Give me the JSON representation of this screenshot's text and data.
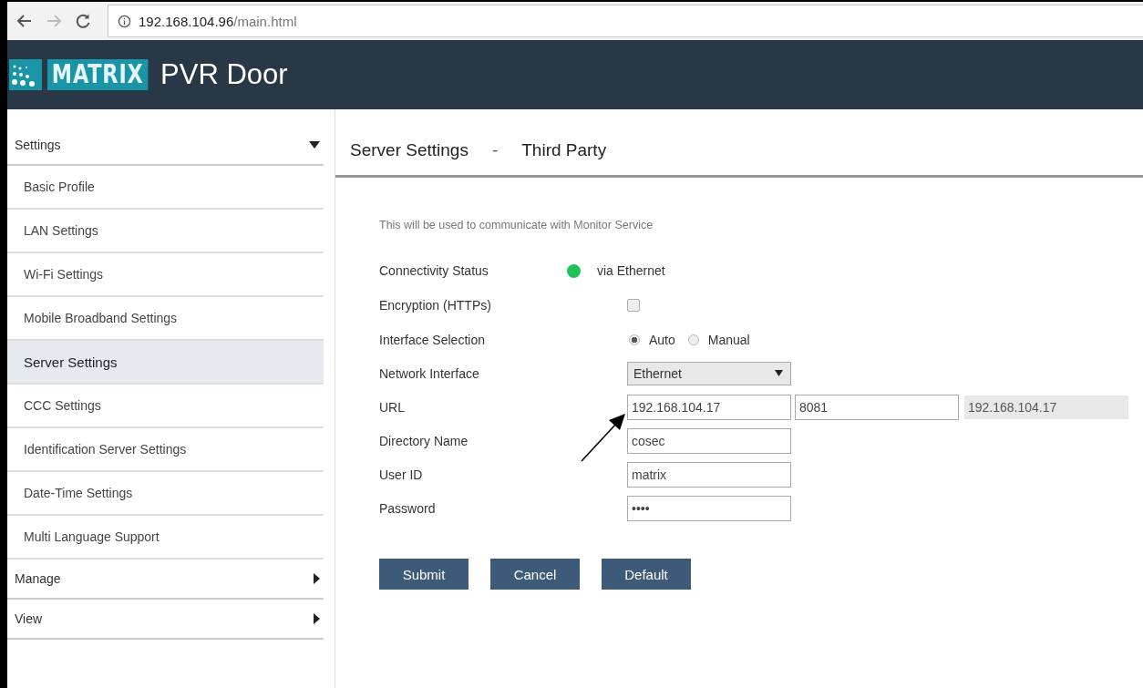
{
  "browser": {
    "url_host": "192.168.104.96",
    "url_path": "/main.html"
  },
  "app": {
    "logo_text": "MATRIX",
    "title": "PVR Door"
  },
  "sidebar": {
    "sections": [
      {
        "label": "Settings",
        "expanded": true,
        "children": [
          {
            "label": "Basic Profile",
            "selected": false
          },
          {
            "label": "LAN Settings",
            "selected": false
          },
          {
            "label": "Wi-Fi Settings",
            "selected": false
          },
          {
            "label": "Mobile Broadband Settings",
            "selected": false
          },
          {
            "label": "Server Settings",
            "selected": true
          },
          {
            "label": "CCC Settings",
            "selected": false
          },
          {
            "label": "Identification Server Settings",
            "selected": false
          },
          {
            "label": "Date-Time Settings",
            "selected": false
          },
          {
            "label": "Multi Language Support",
            "selected": false
          }
        ]
      },
      {
        "label": "Manage",
        "expanded": false
      },
      {
        "label": "View",
        "expanded": false
      }
    ]
  },
  "page": {
    "title": "Server Settings",
    "separator": "-",
    "subtitle": "Third Party",
    "description": "This will be used to communicate with Monitor Service"
  },
  "form": [
    {
      "kind": "status",
      "label": "Connectivity Status",
      "color": "#1ec25a",
      "value": "via Ethernet"
    },
    {
      "kind": "checkbox",
      "label": "Encryption (HTTPs)",
      "checked": false
    },
    {
      "kind": "radio",
      "label": "Interface Selection",
      "options": [
        {
          "label": "Auto",
          "selected": true
        },
        {
          "label": "Manual",
          "selected": false
        }
      ]
    },
    {
      "kind": "select",
      "label": "Network Interface",
      "value": "Ethernet"
    },
    {
      "kind": "url",
      "label": "URL",
      "value": "192.168.104.17",
      "port": "8081",
      "resolved": "192.168.104.17"
    },
    {
      "kind": "text",
      "label": "Directory Name",
      "value": "cosec"
    },
    {
      "kind": "text",
      "label": "User ID",
      "value": "matrix"
    },
    {
      "kind": "password",
      "label": "Password",
      "value": "••••"
    }
  ],
  "buttons": [
    "Submit",
    "Cancel",
    "Default"
  ]
}
